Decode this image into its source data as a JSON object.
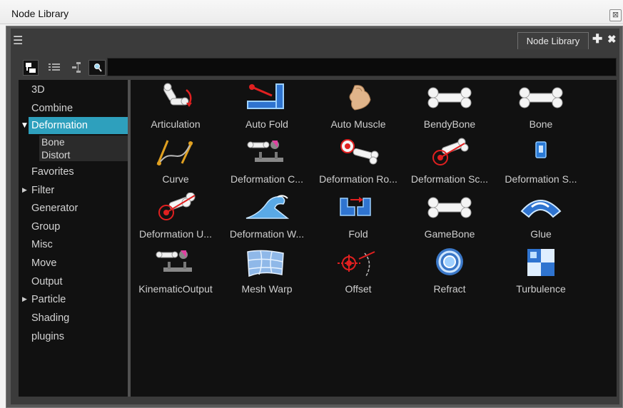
{
  "window": {
    "title": "Node Library",
    "close_glyph": "⊠"
  },
  "panel": {
    "tab_label": "Node Library",
    "menu_icon": "hamburger-icon",
    "add_icon": "plus-icon",
    "close_icon": "close-icon"
  },
  "toolbar": {
    "buttons": [
      "tree-view-icon",
      "list-view-icon",
      "hierarchy-view-icon",
      "search-icon"
    ],
    "search": {
      "value": "",
      "placeholder": ""
    }
  },
  "sidebar": {
    "categories": [
      {
        "label": "3D"
      },
      {
        "label": "Combine"
      },
      {
        "label": "Deformation",
        "expanded": true,
        "selected": true,
        "children": [
          "Bone",
          "Distort"
        ]
      },
      {
        "label": "Favorites"
      },
      {
        "label": "Filter",
        "has_children": true
      },
      {
        "label": "Generator"
      },
      {
        "label": "Group"
      },
      {
        "label": "Misc"
      },
      {
        "label": "Move"
      },
      {
        "label": "Output"
      },
      {
        "label": "Particle",
        "has_children": true
      },
      {
        "label": "Shading"
      },
      {
        "label": "plugins"
      }
    ]
  },
  "nodes": [
    {
      "label": "Articulation",
      "icon": "articulation-icon"
    },
    {
      "label": "Auto Fold",
      "icon": "auto-fold-icon"
    },
    {
      "label": "Auto Muscle",
      "icon": "auto-muscle-icon"
    },
    {
      "label": "BendyBone",
      "icon": "bendy-bone-icon"
    },
    {
      "label": "Bone",
      "icon": "bone-icon"
    },
    {
      "label": "Curve",
      "icon": "curve-icon"
    },
    {
      "label": "Deformation C...",
      "icon": "deformation-composite-icon"
    },
    {
      "label": "Deformation Ro...",
      "icon": "deformation-root-icon"
    },
    {
      "label": "Deformation Sc...",
      "icon": "deformation-scale-icon"
    },
    {
      "label": "Deformation S...",
      "icon": "deformation-switch-icon"
    },
    {
      "label": "Deformation U...",
      "icon": "deformation-uniform-icon"
    },
    {
      "label": "Deformation W...",
      "icon": "deformation-wave-icon"
    },
    {
      "label": "Fold",
      "icon": "fold-icon"
    },
    {
      "label": "GameBone",
      "icon": "game-bone-icon"
    },
    {
      "label": "Glue",
      "icon": "glue-icon"
    },
    {
      "label": "KinematicOutput",
      "icon": "kinematic-output-icon"
    },
    {
      "label": "Mesh Warp",
      "icon": "mesh-warp-icon"
    },
    {
      "label": "Offset",
      "icon": "offset-icon"
    },
    {
      "label": "Refract",
      "icon": "refract-icon"
    },
    {
      "label": "Turbulence",
      "icon": "turbulence-icon"
    }
  ]
}
